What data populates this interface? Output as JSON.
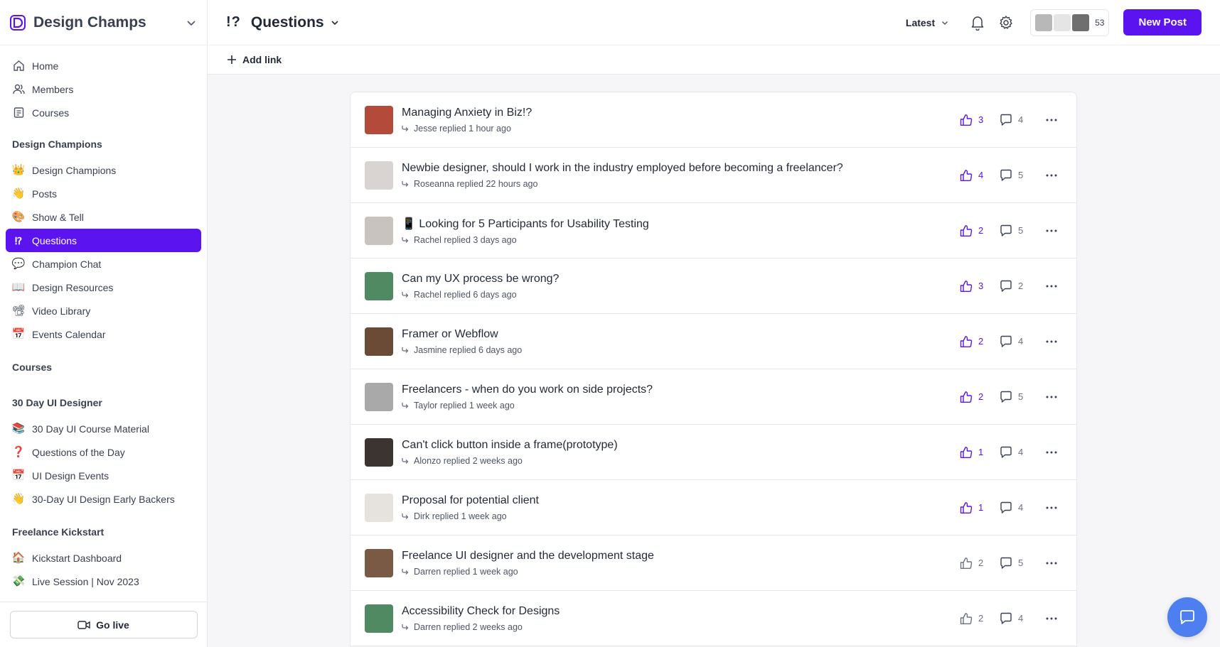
{
  "brand": {
    "name": "Design Champs"
  },
  "nav_top": [
    {
      "label": "Home",
      "icon": "home-icon"
    },
    {
      "label": "Members",
      "icon": "members-icon"
    },
    {
      "label": "Courses",
      "icon": "courses-icon"
    }
  ],
  "sections": [
    {
      "title": "Design Champions",
      "items": [
        {
          "label": "Design Champions",
          "emoji": "👑"
        },
        {
          "label": "Posts",
          "emoji": "👋"
        },
        {
          "label": "Show & Tell",
          "emoji": "🎨"
        },
        {
          "label": "Questions",
          "emoji": "⁉",
          "active": true
        },
        {
          "label": "Champion Chat",
          "emoji": "💬"
        },
        {
          "label": "Design Resources",
          "emoji": "📖"
        },
        {
          "label": "Video Library",
          "emoji": "📽"
        },
        {
          "label": "Events Calendar",
          "emoji": "📅"
        }
      ]
    },
    {
      "title": "Courses",
      "items": []
    },
    {
      "title": "30 Day UI Designer",
      "items": [
        {
          "label": "30 Day UI Course Material",
          "emoji": "📚"
        },
        {
          "label": "Questions of the Day",
          "emoji": "❓"
        },
        {
          "label": "UI Design Events",
          "emoji": "📅"
        },
        {
          "label": "30-Day UI Design Early Backers",
          "emoji": "👋"
        }
      ]
    },
    {
      "title": "Freelance Kickstart",
      "items": [
        {
          "label": "Kickstart Dashboard",
          "emoji": "🏠"
        },
        {
          "label": "Live Session | Nov 2023",
          "emoji": "💸"
        }
      ]
    }
  ],
  "go_live": "Go live",
  "header": {
    "icon_text": "!?",
    "title": "Questions",
    "sort": "Latest",
    "members_count": "53",
    "new_post": "New Post"
  },
  "subbar": {
    "add_link": "Add link"
  },
  "posts": [
    {
      "title": "Managing Anxiety in Biz!?",
      "meta": "Jesse replied 1 hour ago",
      "likes": "3",
      "comments": "4",
      "liked": true,
      "avatar": "#b44a3a"
    },
    {
      "title": "Newbie designer, should I work in the industry employed before becoming a freelancer?",
      "meta": "Roseanna replied 22 hours ago",
      "likes": "4",
      "comments": "5",
      "liked": true,
      "avatar": "#d9d4d1"
    },
    {
      "title": "📱 Looking for 5 Participants for Usability Testing",
      "meta": "Rachel replied 3 days ago",
      "likes": "2",
      "comments": "5",
      "liked": true,
      "avatar": "#c9c3c0"
    },
    {
      "title": "Can my UX process be wrong?",
      "meta": "Rachel replied 6 days ago",
      "likes": "3",
      "comments": "2",
      "liked": true,
      "avatar": "#4f8a63"
    },
    {
      "title": "Framer or Webflow",
      "meta": "Jasmine replied 6 days ago",
      "likes": "2",
      "comments": "4",
      "liked": true,
      "avatar": "#6b4a36"
    },
    {
      "title": "Freelancers - when do you work on side projects?",
      "meta": "Taylor replied 1 week ago",
      "likes": "2",
      "comments": "5",
      "liked": true,
      "avatar": "#a9a9a9"
    },
    {
      "title": "Can't click button inside a frame(prototype)",
      "meta": "Alonzo replied 2 weeks ago",
      "likes": "1",
      "comments": "4",
      "liked": true,
      "avatar": "#3b3431"
    },
    {
      "title": "Proposal for potential client",
      "meta": "Dirk replied 1 week ago",
      "likes": "1",
      "comments": "4",
      "liked": true,
      "avatar": "#e6e2de"
    },
    {
      "title": "Freelance UI designer and the development stage",
      "meta": "Darren replied 1 week ago",
      "likes": "2",
      "comments": "5",
      "liked": false,
      "avatar": "#7a5a44"
    },
    {
      "title": "Accessibility Check for Designs",
      "meta": "Darren replied 2 weeks ago",
      "likes": "2",
      "comments": "4",
      "liked": false,
      "avatar": "#4f8a63"
    }
  ],
  "colors": {
    "accent": "#5b14f0",
    "fab": "#4d7ff0"
  }
}
